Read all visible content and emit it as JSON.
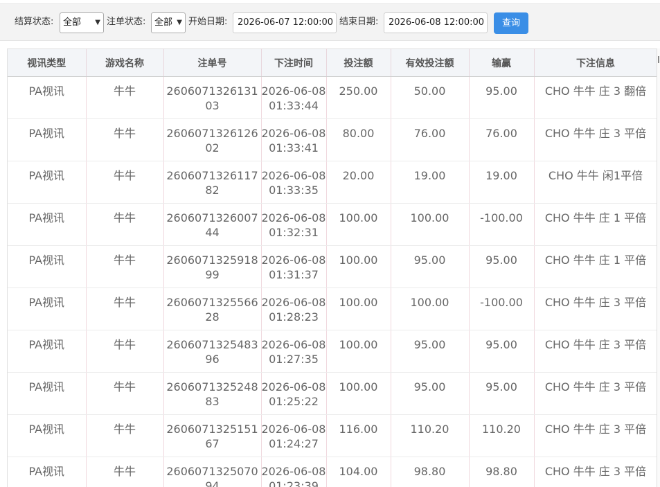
{
  "filters": {
    "settle_status_label": "结算状态:",
    "settle_status_value": "全部",
    "bet_status_label": "注单状态:",
    "bet_status_value": "全部",
    "start_date_label": "开始日期:",
    "start_date_value": "2026-06-07 12:00:00",
    "end_date_label": "结束日期:",
    "end_date_value": "2026-06-08 12:00:00",
    "query_button": "查询"
  },
  "table": {
    "headers": [
      "视讯类型",
      "游戏名称",
      "注单号",
      "下注时间",
      "投注额",
      "有效投注额",
      "输赢",
      "下注信息"
    ],
    "rows": [
      [
        "PA视讯",
        "牛牛",
        "260607132613103",
        "2026-06-08 01:33:44",
        "250.00",
        "50.00",
        "95.00",
        "CHO 牛牛 庄 3 翻倍"
      ],
      [
        "PA视讯",
        "牛牛",
        "260607132612602",
        "2026-06-08 01:33:41",
        "80.00",
        "76.00",
        "76.00",
        "CHO 牛牛 庄 3 平倍"
      ],
      [
        "PA视讯",
        "牛牛",
        "260607132611782",
        "2026-06-08 01:33:35",
        "20.00",
        "19.00",
        "19.00",
        "CHO 牛牛 闲1平倍"
      ],
      [
        "PA视讯",
        "牛牛",
        "260607132600744",
        "2026-06-08 01:32:31",
        "100.00",
        "100.00",
        "-100.00",
        "CHO 牛牛 庄 1 平倍"
      ],
      [
        "PA视讯",
        "牛牛",
        "260607132591899",
        "2026-06-08 01:31:37",
        "100.00",
        "95.00",
        "95.00",
        "CHO 牛牛 庄 1 平倍"
      ],
      [
        "PA视讯",
        "牛牛",
        "260607132556628",
        "2026-06-08 01:28:23",
        "100.00",
        "100.00",
        "-100.00",
        "CHO 牛牛 庄 3 平倍"
      ],
      [
        "PA视讯",
        "牛牛",
        "260607132548396",
        "2026-06-08 01:27:35",
        "100.00",
        "95.00",
        "95.00",
        "CHO 牛牛 庄 3 平倍"
      ],
      [
        "PA视讯",
        "牛牛",
        "260607132524883",
        "2026-06-08 01:25:22",
        "100.00",
        "95.00",
        "95.00",
        "CHO 牛牛 庄 3 平倍"
      ],
      [
        "PA视讯",
        "牛牛",
        "260607132515167",
        "2026-06-08 01:24:27",
        "116.00",
        "110.20",
        "110.20",
        "CHO 牛牛 庄 3 平倍"
      ],
      [
        "PA视讯",
        "牛牛",
        "260607132507094",
        "2026-06-08 01:23:39",
        "104.00",
        "98.80",
        "98.80",
        "CHO 牛牛 庄 3 平倍"
      ]
    ]
  }
}
